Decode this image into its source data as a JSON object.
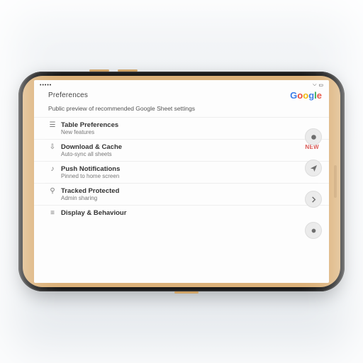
{
  "status": {
    "carrier": "•••••",
    "time": ""
  },
  "header": {
    "title": "Preferences",
    "logo_letters": [
      "G",
      "o",
      "o",
      "g",
      "l",
      "e"
    ],
    "subtitle": "Public preview of recommended Google Sheet settings"
  },
  "groups": [
    {
      "icon": "equalizer",
      "title": "Table Preferences",
      "sub": "New features",
      "badge": ""
    },
    {
      "icon": "download",
      "title": "Download & Cache",
      "sub": "Auto-sync all sheets",
      "badge": "NEW"
    },
    {
      "icon": "bell",
      "title": "Push Notifications",
      "sub": "Pinned to home screen",
      "badge": ""
    },
    {
      "icon": "lock",
      "title": "Tracked Protected",
      "sub": "Admin sharing",
      "badge": ""
    },
    {
      "icon": "sliders",
      "title": "Display & Behaviour",
      "sub": "",
      "badge": ""
    }
  ],
  "rail": [
    {
      "name": "record-button",
      "icon": "dot"
    },
    {
      "name": "send-button",
      "icon": "paperplane"
    },
    {
      "name": "forward-button",
      "icon": "chevron"
    },
    {
      "name": "more-button",
      "icon": "dot"
    }
  ]
}
